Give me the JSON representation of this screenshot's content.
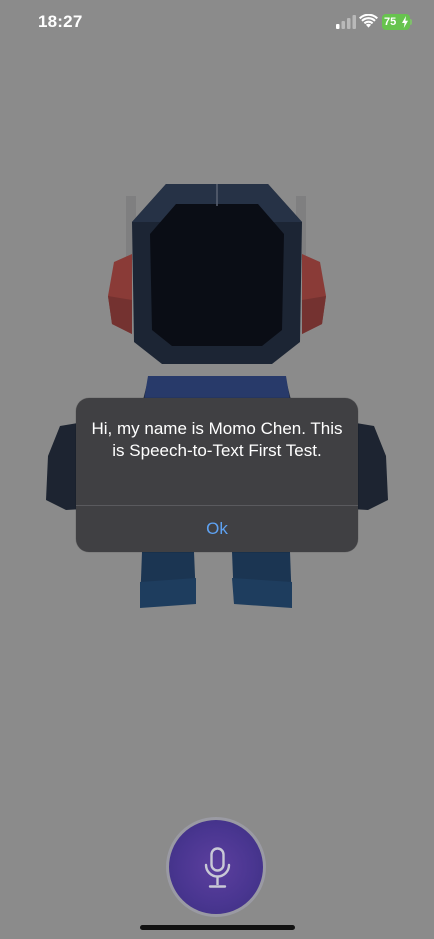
{
  "status_bar": {
    "time": "18:27",
    "battery": "75",
    "icons": [
      "cellular-signal-icon",
      "wifi-icon",
      "battery-icon",
      "charging-bolt-icon"
    ]
  },
  "alert": {
    "message": "Hi, my name is Momo Chen. This is Speech-to-Text First Test.",
    "ok_label": "Ok"
  },
  "mic_button": {
    "icon": "microphone-icon"
  },
  "colors": {
    "dim_background": "#8b8b8b",
    "alert_background": "#404043",
    "alert_action": "#5ea2f2",
    "battery_fill": "#67c34e",
    "mic_button": "#4a3691"
  }
}
